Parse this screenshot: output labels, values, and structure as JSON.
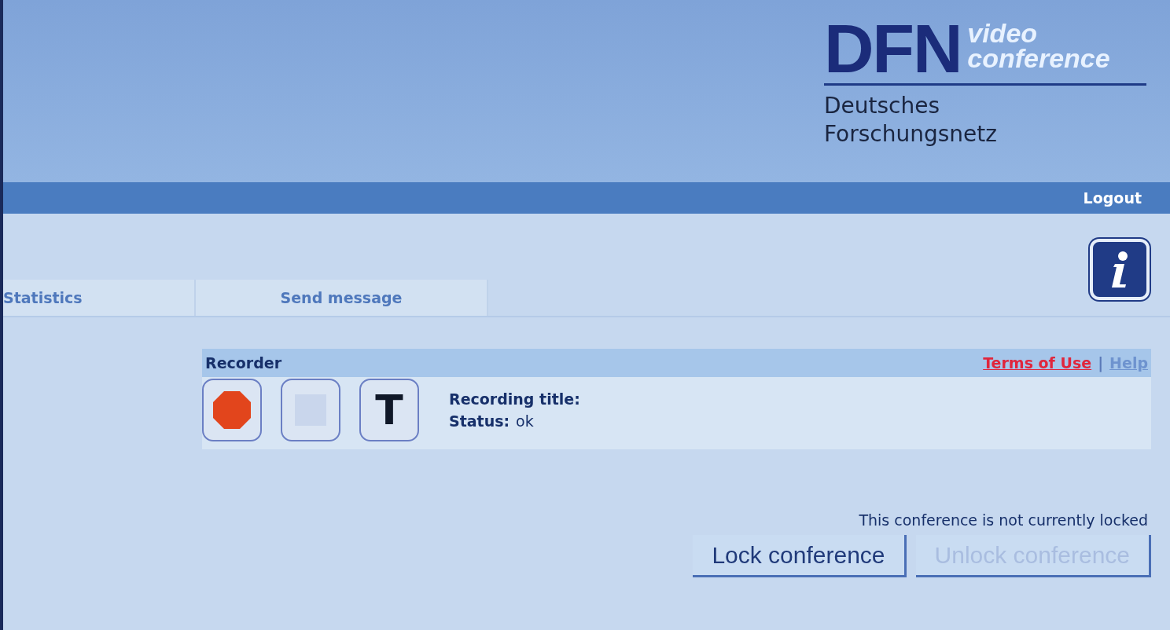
{
  "logo": {
    "brand": "DFN",
    "product_line1": "video",
    "product_line2": "conference",
    "org_line1": "Deutsches",
    "org_line2": "Forschungsnetz"
  },
  "nav": {
    "logout": "Logout"
  },
  "tabs": [
    {
      "label": "Statistics",
      "selected": false
    },
    {
      "label": "Send message",
      "selected": false
    }
  ],
  "recorder": {
    "title": "Recorder",
    "links": [
      {
        "label": "Terms of Use",
        "kind": "terms"
      },
      {
        "label": "Help",
        "kind": "help"
      }
    ],
    "separator": "|",
    "controls": [
      {
        "kind": "record"
      },
      {
        "kind": "stop"
      },
      {
        "kind": "title"
      }
    ],
    "title_glyph": "T",
    "recording_title_label": "Recording title:",
    "status_label": "Status:",
    "status_value": "ok"
  },
  "lock": {
    "message": "This conference is not currently locked",
    "buttons": [
      {
        "label": "Lock conference",
        "disabled": false
      },
      {
        "label": "Unlock conference",
        "disabled": true
      }
    ]
  }
}
